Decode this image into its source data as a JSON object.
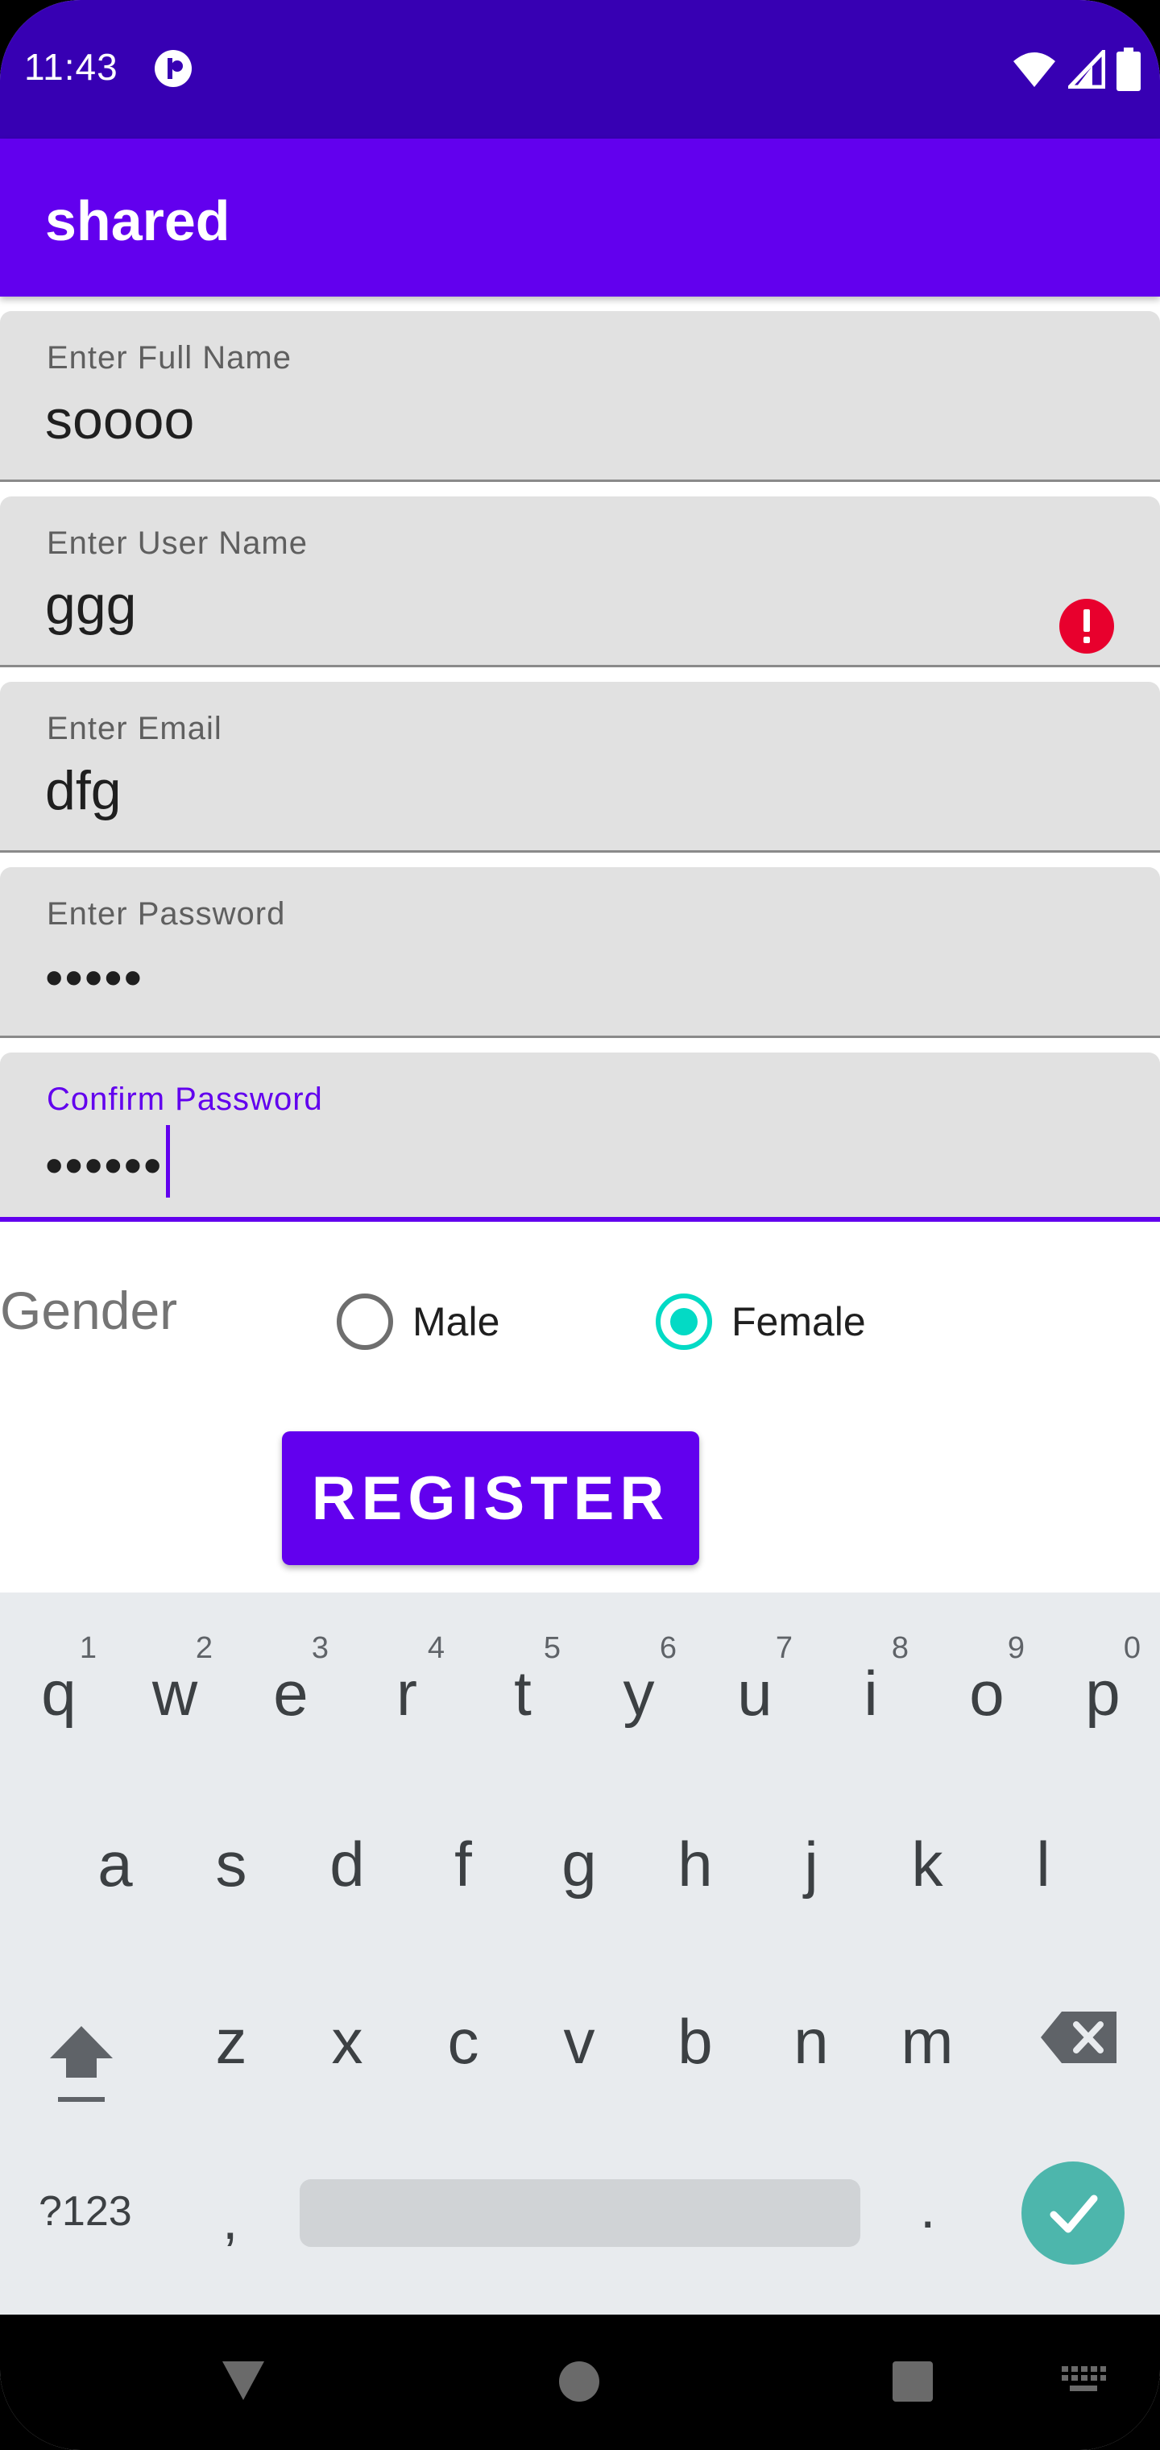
{
  "status_bar": {
    "time": "11:43"
  },
  "app_bar": {
    "title": "shared"
  },
  "form": {
    "fields": [
      {
        "label": "Enter Full Name",
        "value": "soooo"
      },
      {
        "label": "Enter User Name",
        "value": "ggg",
        "error": true
      },
      {
        "label": "Enter Email",
        "value": "dfg"
      },
      {
        "label": "Enter Password",
        "value": "•••••"
      },
      {
        "label": "Confirm Password",
        "value": "••••••",
        "focused": true
      }
    ],
    "gender": {
      "label": "Gender",
      "options": [
        {
          "label": "Male",
          "checked": false
        },
        {
          "label": "Female",
          "checked": true
        }
      ]
    },
    "register_label": "REGISTER"
  },
  "keyboard": {
    "row1": [
      {
        "ch": "q",
        "num": "1"
      },
      {
        "ch": "w",
        "num": "2"
      },
      {
        "ch": "e",
        "num": "3"
      },
      {
        "ch": "r",
        "num": "4"
      },
      {
        "ch": "t",
        "num": "5"
      },
      {
        "ch": "y",
        "num": "6"
      },
      {
        "ch": "u",
        "num": "7"
      },
      {
        "ch": "i",
        "num": "8"
      },
      {
        "ch": "o",
        "num": "9"
      },
      {
        "ch": "p",
        "num": "0"
      }
    ],
    "row2": [
      "a",
      "s",
      "d",
      "f",
      "g",
      "h",
      "j",
      "k",
      "l"
    ],
    "row3": [
      "z",
      "x",
      "c",
      "v",
      "b",
      "n",
      "m"
    ],
    "symbols_label": "?123",
    "comma": ",",
    "period": "."
  },
  "colors": {
    "status_bar": "#3700b3",
    "primary": "#6200ee",
    "accent": "#03dac5",
    "error": "#e8002d",
    "enter_key": "#4db6ac"
  },
  "icons": [
    "app-status-icon",
    "wifi-icon",
    "signal-icon",
    "battery-icon",
    "error-icon",
    "shift-icon",
    "backspace-icon",
    "check-icon",
    "back-icon",
    "home-icon",
    "recents-icon",
    "keyboard-switch-icon"
  ]
}
